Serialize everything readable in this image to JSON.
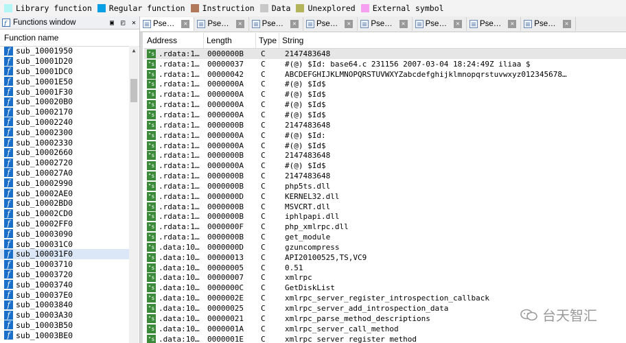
{
  "legend": [
    {
      "label": "Library function",
      "color": "#b4f5f5"
    },
    {
      "label": "Regular function",
      "color": "#0aa0e6"
    },
    {
      "label": "Instruction",
      "color": "#b07a5a"
    },
    {
      "label": "Data",
      "color": "#c8c8c8"
    },
    {
      "label": "Unexplored",
      "color": "#b4b45a"
    },
    {
      "label": "External symbol",
      "color": "#f5a0f0"
    }
  ],
  "functions_window": {
    "title": "Functions window",
    "column_header": "Function name",
    "selected_index": 20,
    "items": [
      "sub_10001950",
      "sub_10001D20",
      "sub_10001DC0",
      "sub_10001E50",
      "sub_10001F30",
      "sub_100020B0",
      "sub_10002170",
      "sub_10002240",
      "sub_10002300",
      "sub_10002330",
      "sub_10002660",
      "sub_10002720",
      "sub_100027A0",
      "sub_10002990",
      "sub_10002AE0",
      "sub_10002BD0",
      "sub_10002CD0",
      "sub_10002FF0",
      "sub_10003090",
      "sub_100031C0",
      "sub_100031F0",
      "sub_10003710",
      "sub_10003720",
      "sub_10003740",
      "sub_100037E0",
      "sub_10003840",
      "sub_10003A30",
      "sub_10003B50",
      "sub_10003BE0"
    ]
  },
  "tabs": [
    {
      "label": "Pse…",
      "active": true
    },
    {
      "label": "Pse…"
    },
    {
      "label": "Pse…"
    },
    {
      "label": "Pse…"
    },
    {
      "label": "Pse…"
    },
    {
      "label": "Pse…"
    },
    {
      "label": "Pse…"
    },
    {
      "label": "Pse…"
    }
  ],
  "strings_window": {
    "columns": {
      "address": "Address",
      "length": "Length",
      "type": "Type",
      "string": "String"
    },
    "selected_index": 0,
    "rows": [
      {
        "address": ".rdata:1…",
        "length": "0000000B",
        "type": "C",
        "string": "2147483648"
      },
      {
        "address": ".rdata:1…",
        "length": "00000037",
        "type": "C",
        "string": "#(@) $Id: base64.c 231156 2007-03-04 18:24:49Z iliaa $"
      },
      {
        "address": ".rdata:1…",
        "length": "00000042",
        "type": "C",
        "string": "ABCDEFGHIJKLMNOPQRSTUVWXYZabcdefghijklmnopqrstuvwxyz012345678…"
      },
      {
        "address": ".rdata:1…",
        "length": "0000000A",
        "type": "C",
        "string": "#(@) $Id$"
      },
      {
        "address": ".rdata:1…",
        "length": "0000000A",
        "type": "C",
        "string": "#(@) $Id$"
      },
      {
        "address": ".rdata:1…",
        "length": "0000000A",
        "type": "C",
        "string": "#(@) $Id$"
      },
      {
        "address": ".rdata:1…",
        "length": "0000000A",
        "type": "C",
        "string": "#(@) $Id$"
      },
      {
        "address": ".rdata:1…",
        "length": "0000000B",
        "type": "C",
        "string": "2147483648"
      },
      {
        "address": ".rdata:1…",
        "length": "0000000A",
        "type": "C",
        "string": "#(@) $Id:"
      },
      {
        "address": ".rdata:1…",
        "length": "0000000A",
        "type": "C",
        "string": "#(@) $Id$"
      },
      {
        "address": ".rdata:1…",
        "length": "0000000B",
        "type": "C",
        "string": "2147483648"
      },
      {
        "address": ".rdata:1…",
        "length": "0000000A",
        "type": "C",
        "string": "#(@) $Id$"
      },
      {
        "address": ".rdata:1…",
        "length": "0000000B",
        "type": "C",
        "string": "2147483648"
      },
      {
        "address": ".rdata:1…",
        "length": "0000000B",
        "type": "C",
        "string": "php5ts.dll"
      },
      {
        "address": ".rdata:1…",
        "length": "0000000D",
        "type": "C",
        "string": "KERNEL32.dll"
      },
      {
        "address": ".rdata:1…",
        "length": "0000000B",
        "type": "C",
        "string": "MSVCRT.dll"
      },
      {
        "address": ".rdata:1…",
        "length": "0000000B",
        "type": "C",
        "string": "iphlpapi.dll"
      },
      {
        "address": ".rdata:1…",
        "length": "0000000F",
        "type": "C",
        "string": "php_xmlrpc.dll"
      },
      {
        "address": ".rdata:1…",
        "length": "0000000B",
        "type": "C",
        "string": "get_module"
      },
      {
        "address": ".data:10…",
        "length": "0000000D",
        "type": "C",
        "string": "gzuncompress"
      },
      {
        "address": ".data:10…",
        "length": "00000013",
        "type": "C",
        "string": "API20100525,TS,VC9"
      },
      {
        "address": ".data:10…",
        "length": "00000005",
        "type": "C",
        "string": "0.51"
      },
      {
        "address": ".data:10…",
        "length": "00000007",
        "type": "C",
        "string": "xmlrpc"
      },
      {
        "address": ".data:10…",
        "length": "0000000C",
        "type": "C",
        "string": "GetDiskList"
      },
      {
        "address": ".data:10…",
        "length": "0000002E",
        "type": "C",
        "string": "xmlrpc_server_register_introspection_callback"
      },
      {
        "address": ".data:10…",
        "length": "00000025",
        "type": "C",
        "string": "xmlrpc_server_add_introspection_data"
      },
      {
        "address": ".data:10…",
        "length": "00000021",
        "type": "C",
        "string": "xmlrpc_parse_method_descriptions"
      },
      {
        "address": ".data:10…",
        "length": "0000001A",
        "type": "C",
        "string": "xmlrpc_server_call_method"
      },
      {
        "address": ".data:10…",
        "length": "0000001E",
        "type": "C",
        "string": "xmlrpc_server_register_method"
      }
    ]
  },
  "watermark": {
    "text": "台天智汇"
  },
  "icons": {
    "function": "function-icon",
    "string": "string-icon",
    "close": "close-icon",
    "restore": "restore-icon",
    "window": "functions-window-icon",
    "watermark": "wechat-icon"
  }
}
